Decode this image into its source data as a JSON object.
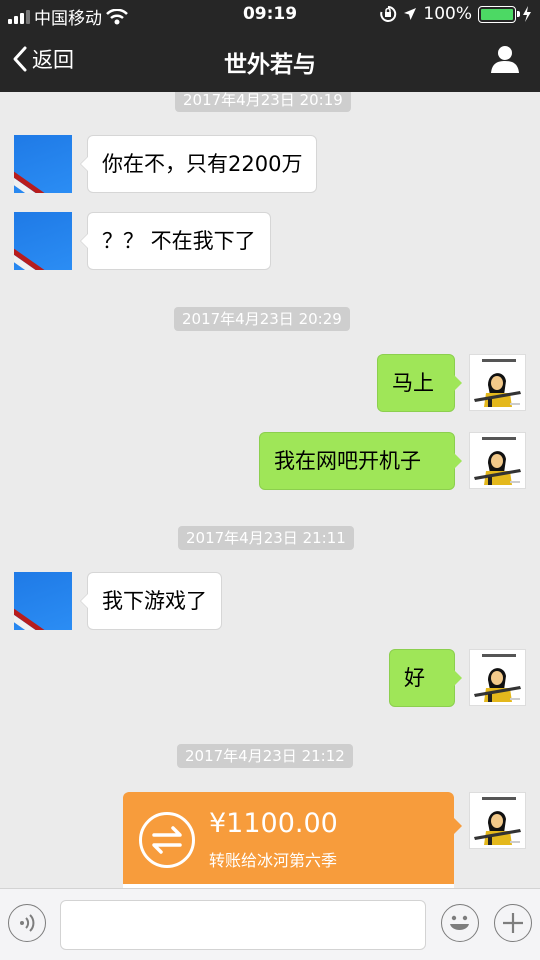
{
  "status_bar": {
    "carrier": "中国移动",
    "time": "09:19",
    "battery": "100%",
    "battery_level": 1.0,
    "icons": [
      "signal-icon",
      "wifi-icon",
      "rotation-lock-icon",
      "location-icon",
      "battery-icon",
      "charging-icon"
    ]
  },
  "nav": {
    "back_label": "返回",
    "title": "世外若与",
    "icons": [
      "chevron-left-icon",
      "user-icon"
    ]
  },
  "messages": [
    {
      "type": "timestamp",
      "text": "2017年4月23日 20:19"
    },
    {
      "type": "text",
      "side": "in",
      "text": "你在不，只有2200万"
    },
    {
      "type": "text",
      "side": "in",
      "text": "？？ 不在我下了"
    },
    {
      "type": "timestamp",
      "text": "2017年4月23日 20:29"
    },
    {
      "type": "text",
      "side": "out",
      "text": "马上"
    },
    {
      "type": "text",
      "side": "out",
      "text": "我在网吧开机子"
    },
    {
      "type": "timestamp",
      "text": "2017年4月23日 21:11"
    },
    {
      "type": "text",
      "side": "in",
      "text": "我下游戏了"
    },
    {
      "type": "text",
      "side": "out",
      "text": "好"
    },
    {
      "type": "timestamp",
      "text": "2017年4月23日 21:12"
    },
    {
      "type": "transfer",
      "side": "out",
      "amount": "¥1100.00",
      "description": "转账给冰河第六季"
    }
  ],
  "input_bar": {
    "placeholder": "",
    "icons": [
      "voice-icon",
      "emoji-icon",
      "plus-icon"
    ]
  },
  "colors": {
    "bar_bg": "#262626",
    "chat_bg": "#ebebeb",
    "outgoing_bubble": "#9fe658",
    "incoming_bubble": "#ffffff",
    "transfer_card": "#f79c3c",
    "battery_fill": "#4cd964"
  }
}
